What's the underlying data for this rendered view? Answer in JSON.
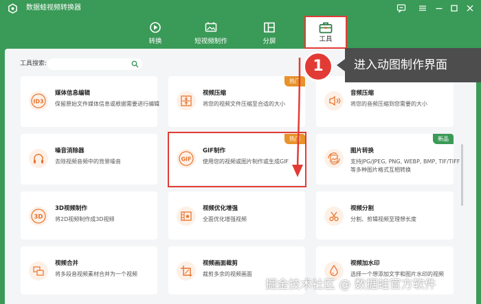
{
  "window": {
    "title": "数据蛙视频转换器"
  },
  "nav": [
    {
      "label": "转换"
    },
    {
      "label": "短视频制作"
    },
    {
      "label": "分屏"
    },
    {
      "label": "工具"
    }
  ],
  "search": {
    "label": "工具搜索:",
    "placeholder": ""
  },
  "annotation": {
    "step": "1",
    "text": "进入动图制作界面"
  },
  "badges": {
    "hot": "热门",
    "new": "新品"
  },
  "cards": [
    {
      "title": "媒体信息编辑",
      "desc": "保留原始文件媒体信息或根据需要进行编辑",
      "icon": "id3-icon"
    },
    {
      "title": "视频压缩",
      "desc": "将您的视频文件压缩至合适的大小",
      "icon": "compress-icon"
    },
    {
      "title": "音频压缩",
      "desc": "将您的音频压缩到您需要的大小",
      "icon": "audio-compress-icon"
    },
    {
      "title": "噪音消除器",
      "desc": "去除视频音频中的背景噪音",
      "icon": "headphones-icon"
    },
    {
      "title": "GIF制作",
      "desc": "使用您的视频或图片制作或生成GIF",
      "icon": "gif-icon"
    },
    {
      "title": "图片转换",
      "desc": "支持JPG/JPEG, PNG, WEBP, BMP, TIF/TIFF等多种图片格式互相转换",
      "icon": "image-convert-icon"
    },
    {
      "title": "3D视频制作",
      "desc": "将2D视频制作成3D视频",
      "icon": "3d-icon"
    },
    {
      "title": "视频优化增强",
      "desc": "全面优化增强视频",
      "icon": "enhance-icon"
    },
    {
      "title": "视频分割",
      "desc": "分割、剪辑视频至理想长度",
      "icon": "scissors-icon"
    },
    {
      "title": "视频合并",
      "desc": "将多段音视频素材合并为一个视频",
      "icon": "merge-icon"
    },
    {
      "title": "视频画面裁剪",
      "desc": "裁剪多余的视频画面",
      "icon": "crop-icon"
    },
    {
      "title": "视频加水印",
      "desc": "选择一个想添加文字和图片水印的视频",
      "icon": "watermark-icon"
    }
  ],
  "watermark": "掘金技术社区 @ 数据蛙官方软件",
  "colors": {
    "brand": "#3a9a57",
    "accent": "#e8722a",
    "highlight": "#e23b35",
    "new_badge": "#3a9a57"
  }
}
